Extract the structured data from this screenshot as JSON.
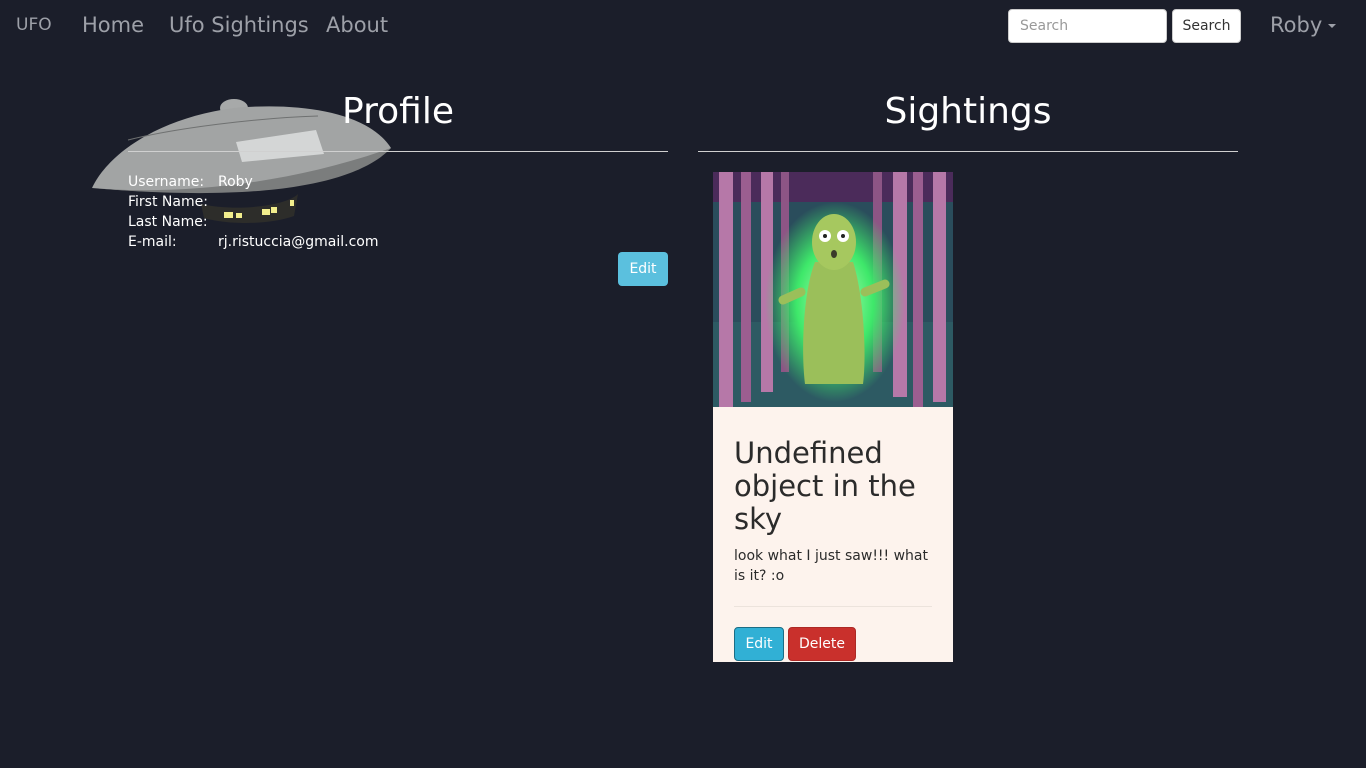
{
  "navbar": {
    "brand": "UFO",
    "links": [
      "Home",
      "Ufo Sightings",
      "About"
    ],
    "search_placeholder": "Search",
    "search_button": "Search",
    "user": "Roby"
  },
  "profile": {
    "title": "Profile",
    "fields": [
      {
        "label": "Username:",
        "value": "Roby"
      },
      {
        "label": "First Name:",
        "value": ""
      },
      {
        "label": "Last Name:",
        "value": ""
      },
      {
        "label": "E-mail:",
        "value": "rj.ristuccia@gmail.com"
      }
    ],
    "edit_label": "Edit"
  },
  "sightings": {
    "title": "Sightings",
    "cards": [
      {
        "title": "Undefined object in the sky",
        "text": "look what I just saw!!! what is it? :o",
        "edit_label": "Edit",
        "delete_label": "Delete"
      }
    ]
  },
  "colors": {
    "background": "#1b1e2a",
    "info": "#5bc0de",
    "danger": "#c9302c",
    "card": "#fdf3ed"
  }
}
